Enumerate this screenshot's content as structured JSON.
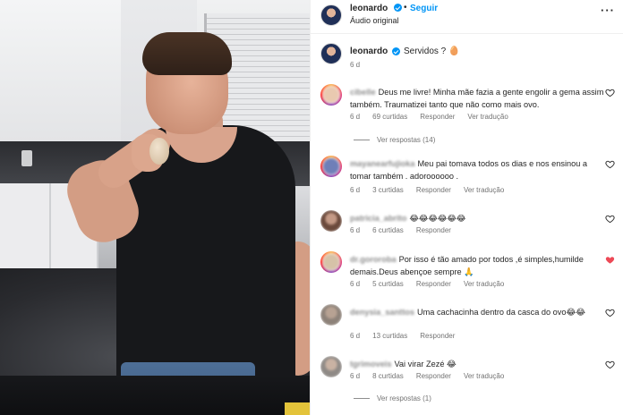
{
  "media": {
    "alt": ""
  },
  "header": {
    "username": "leonardo",
    "dot": "•",
    "follow_label": "Seguir",
    "audio": "Áudio original",
    "more": "···"
  },
  "caption": {
    "username": "leonardo",
    "text": "Servidos ? 🥚",
    "time": "6 d"
  },
  "comments": [
    {
      "user": "cibelle",
      "text": "Deus me livre! Minha mãe fazia a gente engolir a gema assim também. Traumatizei tanto que não como mais ovo.",
      "time": "6 d",
      "likes": "69 curtidas",
      "reply": "Responder",
      "translate": "Ver tradução",
      "liked": false
    },
    {
      "user": "mayanearfujioka",
      "text": "Meu pai tomava todos os dias e nos ensinou a tomar também . adoroooooo .",
      "time": "6 d",
      "likes": "3 curtidas",
      "reply": "Responder",
      "translate": "Ver tradução",
      "liked": false
    },
    {
      "user": "patricia_abrito",
      "text": "😂😂😂😂😂😂",
      "time": "6 d",
      "likes": "6 curtidas",
      "reply": "Responder",
      "translate": "",
      "liked": false
    },
    {
      "user": "dr.gororoba",
      "text": "Por isso é tão amado por todos ,é simples,humilde demais.Deus abençoe sempre 🙏",
      "time": "6 d",
      "likes": "5 curtidas",
      "reply": "Responder",
      "translate": "Ver tradução",
      "liked": true
    },
    {
      "user": "denysia_santtos",
      "text": "Uma cachacinha dentro da casca do ovo😂😂",
      "time": "6 d",
      "likes": "13 curtidas",
      "reply": "Responder",
      "translate": "",
      "liked": false
    },
    {
      "user": "tgrimoveis",
      "text": "Vai virar Zezé 😂",
      "time": "6 d",
      "likes": "8 curtidas",
      "reply": "Responder",
      "translate": "Ver tradução",
      "liked": false
    }
  ],
  "view_replies": [
    {
      "label": "Ver respostas (14)"
    },
    {
      "label": "Ver respostas (1)"
    }
  ],
  "colors": {
    "link_blue": "#0095f6",
    "heart_liked": "#ed4956",
    "secondary_text": "#737373"
  }
}
